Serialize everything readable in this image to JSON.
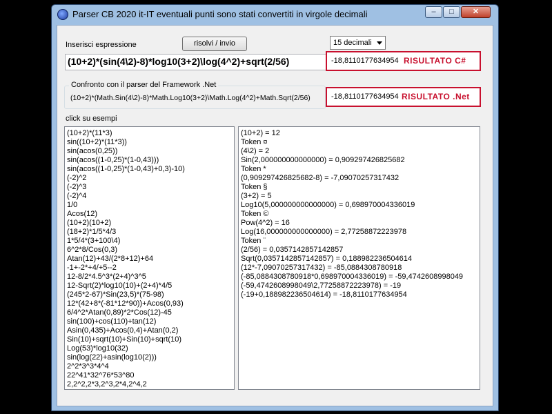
{
  "window": {
    "title": "Parser CB 2020 it-IT  eventuali punti sono stati convertiti in virgole decimali",
    "min_glyph": "–",
    "max_glyph": "□",
    "close_glyph": "✕",
    "icon": "globe-app-icon"
  },
  "form": {
    "input_label": "Inserisci espressione",
    "solve_button": "risolvi / invio",
    "decimals_selected": "15 decimali",
    "expression": "(10+2)*(sin(4\\2)-8)*log10(3+2)\\log(4^2)+sqrt(2/56)",
    "result_csharp": "-18,8110177634954",
    "result_csharp_tag": "RISULTATO C#",
    "framework_group_title": "Confronto con il parser del Framework .Net",
    "framework_expression": "(10+2)*(Math.Sin(4\\2)-8)*Math.Log10(3+2)\\Math.Log(4^2)+Math.Sqrt(2/56)",
    "result_net": "-18,8110177634954",
    "result_net_tag": "RISULTATO .Net",
    "examples_label": "click su esempi"
  },
  "examples": [
    "(10+2)*(11*3)",
    "sin((10+2)*(11*3))",
    "sin(acos(0,25))",
    "sin(acos((1-0,25)*(1-0,43)))",
    "sin(acos((1-0,25)*(1-0,43)+0,3)-10)",
    "(-2)^2",
    "(-2)^3",
    "(-2)^4",
    "1/0",
    "Acos(12)",
    "(10+2)(10+2)",
    "(18+2)*1/5*4/3",
    "1*5/4*(3+100\\4)",
    "6^2*8/Cos(0,3)",
    "Atan(12)+43/(2*8+12)+64",
    "-1+-2*+4/+5--2",
    "12-8/2*4.5^3*(2+4)^3^5",
    "12-Sqrt(2)*log10(10)+(2+4)*4/5",
    "(245*2-67)*Sin(23,5)*(75-98)",
    "12*(42+8*(-81*12*90))+Acos(0,93)",
    "6/4^2*Atan(0,89)*2*Cos(12)-45",
    "sin(100)+cos(110)+tan(12)",
    "Asin(0,435)+Acos(0,4)+Atan(0,2)",
    "Sin(10)+sqrt(10)+Sin(10)+sqrt(10)",
    "Log(53)*log10(32)",
    "sin(log(22)+asin(log10(2)))",
    "2^2*3^3*4^4",
    "22^41*32^76*53^80",
    "2,2^2,2*3,2^3,2*4,2^4,2"
  ],
  "steps": [
    "(10+2) = 12",
    "Token ¤",
    "(4\\2) = 2",
    "Sin(2,000000000000000) = 0,909297426825682",
    "Token *",
    "(0,909297426825682-8) = -7,09070257317432",
    "Token §",
    "(3+2) = 5",
    "Log10(5,000000000000000) = 0,698970004336019",
    "Token ©",
    "Pow(4^2) = 16",
    "Log(16,000000000000000) = 2,77258872223978",
    "Token ¨",
    "(2/56) = 0,0357142857142857",
    "Sqrt(0,0357142857142857) = 0,188982236504614",
    "(12*-7,09070257317432) = -85,0884308780918",
    "(-85,0884308780918*0,698970004336019) = -59,4742608998049",
    "(-59,4742608998049\\2,77258872223978) = -19",
    "(-19+0,188982236504614) = -18,8110177634954"
  ]
}
